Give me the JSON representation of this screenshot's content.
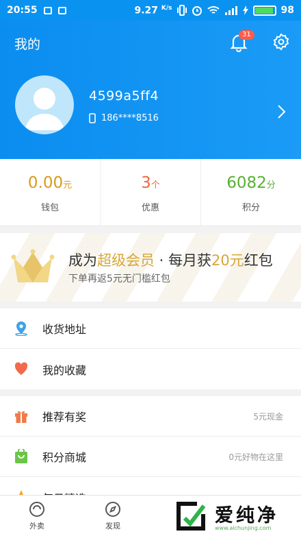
{
  "status_bar": {
    "time": "20:55",
    "speed": "9.27",
    "speed_unit": "K/s",
    "battery": "98"
  },
  "header": {
    "title": "我的",
    "notification_count": "31",
    "username": "4599a5ff4",
    "phone": "186****8516"
  },
  "stats": {
    "wallet": {
      "value": "0.00",
      "unit": "元",
      "label": "钱包",
      "color": "#d89a1c"
    },
    "coupons": {
      "value": "3",
      "unit": "个",
      "label": "优惠",
      "color": "#f0663f"
    },
    "points": {
      "value": "6082",
      "unit": "分",
      "label": "积分",
      "color": "#58b135"
    }
  },
  "vip_banner": {
    "title_1": "成为",
    "title_2": "超级会员",
    "title_3": " · 每月获",
    "title_4": "20元",
    "title_5": "红包",
    "subtitle": "下单再返5元无门槛红包"
  },
  "menu_group_1": [
    {
      "label": "收货地址",
      "icon": "location-pin-icon"
    },
    {
      "label": "我的收藏",
      "icon": "heart-icon"
    }
  ],
  "menu_group_2": [
    {
      "label": "推荐有奖",
      "extra": "5元现金",
      "icon": "gift-icon"
    },
    {
      "label": "积分商城",
      "extra": "0元好物在这里",
      "icon": "shopping-bag-icon"
    },
    {
      "label": "每日精选",
      "extra": "",
      "icon": "star-icon"
    }
  ],
  "tab_bar": [
    {
      "label": "外卖"
    },
    {
      "label": "发现"
    }
  ],
  "watermark": {
    "text": "爱纯净",
    "url": "www.aichunjing.com"
  }
}
